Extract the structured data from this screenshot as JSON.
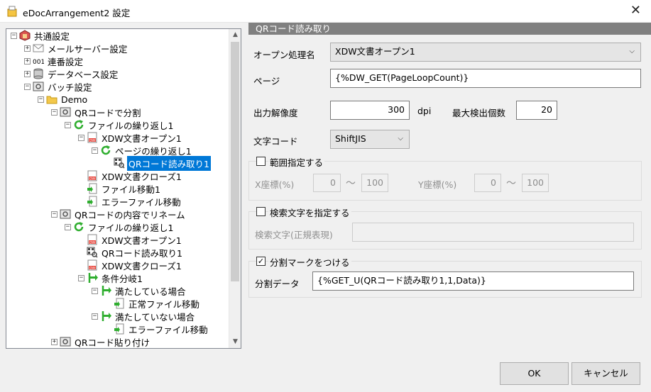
{
  "window": {
    "title": "eDocArrangement2 設定",
    "close_glyph": "✕"
  },
  "tree": [
    {
      "label": "共通設定",
      "icon": "settings-icon",
      "expander": "−",
      "level": 0
    },
    {
      "label": "メールサーバー設定",
      "icon": "mail-icon",
      "expander": "+",
      "level": 1
    },
    {
      "label": "連番設定",
      "icon": "counter-icon",
      "expander": "+",
      "level": 1
    },
    {
      "label": "データベース設定",
      "icon": "database-icon",
      "expander": "+",
      "level": 1
    },
    {
      "label": "バッチ設定",
      "icon": "batch-icon",
      "expander": "−",
      "level": 1
    },
    {
      "label": "Demo",
      "icon": "folder-icon",
      "expander": "−",
      "level": 2
    },
    {
      "label": "QRコードで分割",
      "icon": "batch-icon",
      "expander": "−",
      "level": 3
    },
    {
      "label": "ファイルの繰り返し1",
      "icon": "loop-icon",
      "expander": "−",
      "level": 4
    },
    {
      "label": "XDW文書オープン1",
      "icon": "xdw-icon",
      "expander": "−",
      "level": 5
    },
    {
      "label": "ページの繰り返し1",
      "icon": "loop-icon",
      "expander": "−",
      "level": 6
    },
    {
      "label": "QRコード読み取り1",
      "icon": "qr-icon",
      "expander": "",
      "level": 7,
      "selected": true
    },
    {
      "label": "XDW文書クローズ1",
      "icon": "xdw-icon",
      "expander": "",
      "level": 5
    },
    {
      "label": "ファイル移動1",
      "icon": "file-move-icon",
      "expander": "",
      "level": 5
    },
    {
      "label": "エラーファイル移動",
      "icon": "file-move-icon",
      "expander": "",
      "level": 5
    },
    {
      "label": "QRコードの内容でリネーム",
      "icon": "batch-icon",
      "expander": "−",
      "level": 3
    },
    {
      "label": "ファイルの繰り返し1",
      "icon": "loop-icon",
      "expander": "−",
      "level": 4
    },
    {
      "label": "XDW文書オープン1",
      "icon": "xdw-icon",
      "expander": "",
      "level": 5
    },
    {
      "label": "QRコード読み取り1",
      "icon": "qr-icon",
      "expander": "",
      "level": 5
    },
    {
      "label": "XDW文書クローズ1",
      "icon": "xdw-icon",
      "expander": "",
      "level": 5
    },
    {
      "label": "条件分岐1",
      "icon": "branch-icon",
      "expander": "−",
      "level": 5
    },
    {
      "label": "満たしている場合",
      "icon": "branch-icon",
      "expander": "−",
      "level": 6
    },
    {
      "label": "正常ファイル移動",
      "icon": "file-move-icon",
      "expander": "",
      "level": 7
    },
    {
      "label": "満たしていない場合",
      "icon": "branch-icon",
      "expander": "−",
      "level": 6
    },
    {
      "label": "エラーファイル移動",
      "icon": "file-move-icon",
      "expander": "",
      "level": 7
    },
    {
      "label": "QRコード貼り付け",
      "icon": "batch-icon",
      "expander": "+",
      "level": 3
    }
  ],
  "panel": {
    "header": "QRコード読み取り",
    "open_process_label": "オープン処理名",
    "open_process_value": "XDW文書オープン1",
    "page_label": "ページ",
    "page_value": "{%DW_GET(PageLoopCount)}",
    "resolution_label": "出力解像度",
    "resolution_value": "300",
    "resolution_unit": "dpi",
    "max_detect_label": "最大検出個数",
    "max_detect_value": "20",
    "charset_label": "文字コード",
    "charset_value": "ShiftJIS",
    "range_check_label": "範囲指定する",
    "range_checked": false,
    "x_label": "X座標(%)",
    "x_from": "0",
    "x_to": "100",
    "y_label": "Y座標(%)",
    "y_from": "0",
    "y_to": "100",
    "tilde": "〜",
    "search_check_label": "検索文字を指定する",
    "search_checked": false,
    "search_label": "検索文字(正規表現)",
    "search_value": "",
    "split_check_label": "分割マークをつける",
    "split_checked": true,
    "split_data_label": "分割データ",
    "split_data_value": "{%GET_U(QRコード読み取り1,1,Data)}",
    "check_glyph": "✓",
    "chevron_glyph": "⌵"
  },
  "buttons": {
    "ok": "OK",
    "cancel": "キャンセル"
  }
}
